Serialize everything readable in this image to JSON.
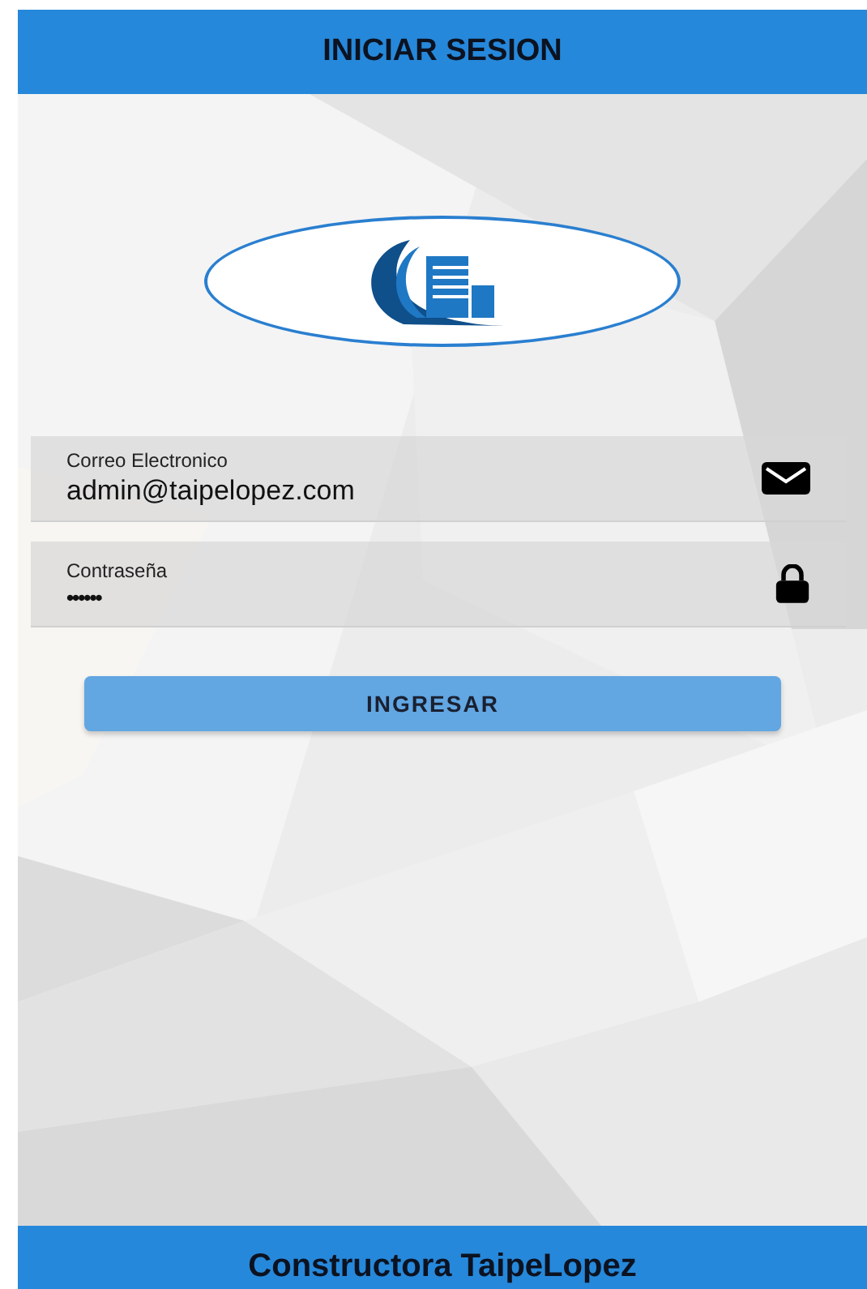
{
  "header": {
    "title": "INICIAR SESION"
  },
  "form": {
    "fields": [
      {
        "kind": "email",
        "label": "Correo Electronico",
        "value": "admin@taipelopez.com"
      },
      {
        "kind": "password",
        "label": "Contraseña",
        "value": "••••••"
      }
    ],
    "submit": "INGRESAR"
  },
  "footer": {
    "title": "Constructora TaipeLopez"
  }
}
